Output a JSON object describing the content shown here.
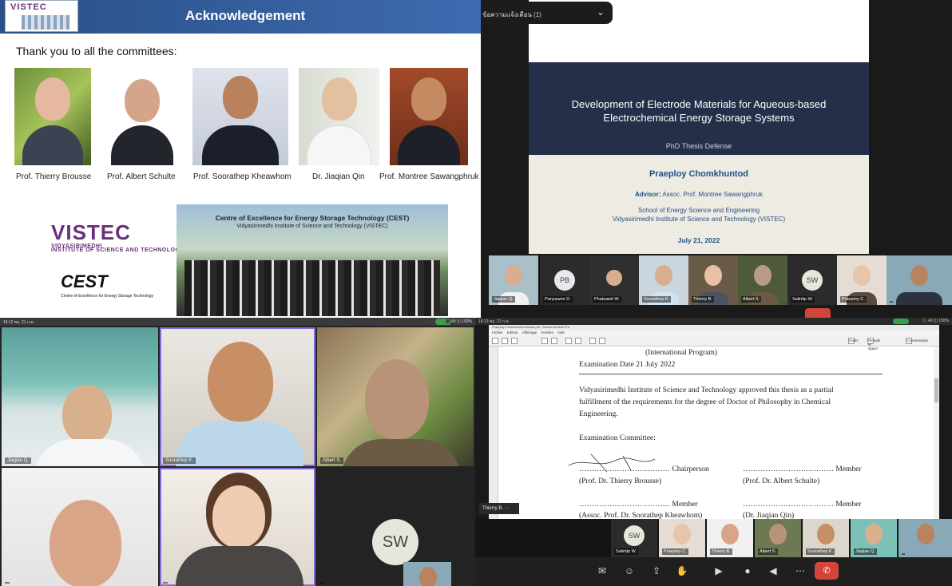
{
  "q1": {
    "logo_text": "VISTEC",
    "title": "Acknowledgement",
    "thanks": "Thank you to all the committees:",
    "people": [
      {
        "name": "Prof. Thierry Brousse"
      },
      {
        "name": "Prof. Albert Schulte"
      },
      {
        "name": "Prof. Soorathep Kheawhom"
      },
      {
        "name": "Dr. Jiaqian Qin"
      },
      {
        "name": "Prof. Montree Sawangphruk"
      }
    ],
    "vistec": {
      "name": "VISTEC",
      "sub": "VIDYASIRIMEDHI",
      "sub2": "INSTITUTE OF SCIENCE AND TECHNOLOGY"
    },
    "cest": {
      "name": "CEST",
      "sub": "Centre of Excellence for Energy Storage Technology"
    },
    "group_title": "Centre of Excellence for Energy Storage Technology (CEST)",
    "group_sub": "Vidyasirimedhi Institute of Science and Technology (VISTEC)"
  },
  "q2": {
    "notification": "ข้อความแจ้งเตือน (1)",
    "title_line1": "Development of Electrode Materials for Aqueous-based",
    "title_line2": "Electrochemical Energy Storage Systems",
    "phd": "PhD Thesis Defense",
    "author": "Praeploy Chomkhuntod",
    "advisor_label": "Advisor:",
    "advisor": "Assoc. Prof. Montree Sawangphruk",
    "school": "School of Energy Science and Engineering",
    "institute": "Vidyasirimedhi Institute of Science and Technology (VISTEC)",
    "date": "July 21, 2022",
    "tiles": [
      {
        "label": "Jiaqian Q."
      },
      {
        "label": "Panyawee D.",
        "avatar": "PB"
      },
      {
        "label": "Phatsawit W."
      },
      {
        "label": "Soorathep K."
      },
      {
        "label": "Thierry B."
      },
      {
        "label": "Albert S."
      },
      {
        "label": "Salintip W.",
        "avatar": "SW"
      },
      {
        "label": "Praeploy C."
      },
      {
        "label": ""
      }
    ]
  },
  "q3": {
    "time": "16:12  พฤ. 21 ก.ค.",
    "status": "⚫ 40 ◫ 100%",
    "tiles": [
      {
        "label": "Jiaqian Q."
      },
      {
        "label": "Soorathep K."
      },
      {
        "label": "Albert S."
      },
      {
        "label": ""
      },
      {
        "label": ""
      },
      {
        "label": ""
      }
    ],
    "sw_avatar": "SW"
  },
  "q4": {
    "time": "16:13  พฤ. 21 ก.ค.",
    "status": "⚫ 40 ◫ 100%",
    "window_title": "Praeploy Chomkhuntod thesis.pdf - Adobe Acrobat Pro",
    "menu": "Fichier Edition Affichage Fenêtre Aide",
    "tools_right": [
      "Outils",
      "Remplir et signer",
      "Commentaire"
    ],
    "doc": {
      "program": "(International Program)",
      "exam_date": "Examination Date  21 July 2022",
      "para1": "Vidyasirimedhi Institute of Science and Technology approved this thesis as a partial",
      "para2": "fulfillment of the requirements for the degree of Doctor of Philosophy in Chemical",
      "para3": "Engineering.",
      "committee": "Examination Committee:",
      "r1_left": "……………………………… Chairperson",
      "r1_right": "……………………………… Member",
      "r1_left_name": "(Prof. Dr. Thierry Brousse)",
      "r1_right_name": "(Prof. Dr. Albert Schulte)",
      "r2_left": "……………………………… Member",
      "r2_right": "……………………………… Member",
      "r2_left_name": "(Assoc. Prof. Dr. Soorathep Kheawhom)",
      "r2_right_name": "(Dr. Jiaqian Qin)"
    },
    "thumb_label": "Thierry B.",
    "tiles": [
      {
        "label": "Salintip W.",
        "avatar": "SW"
      },
      {
        "label": "Praeploy C."
      },
      {
        "label": "Thierry B."
      },
      {
        "label": "Albert S."
      },
      {
        "label": "Soorathep K."
      },
      {
        "label": "Jiaqian Q."
      },
      {
        "label": ""
      }
    ]
  }
}
